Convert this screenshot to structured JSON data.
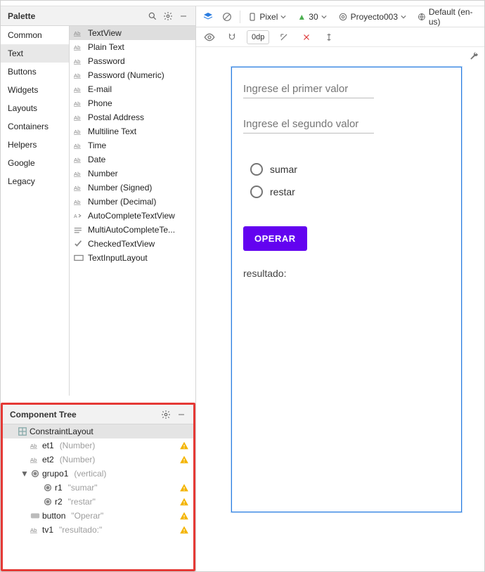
{
  "palette": {
    "title": "Palette",
    "categories": [
      "Common",
      "Text",
      "Buttons",
      "Widgets",
      "Layouts",
      "Containers",
      "Helpers",
      "Google",
      "Legacy"
    ],
    "selected_category": "Text",
    "items": [
      {
        "icon": "ab",
        "label": "TextView",
        "selected": true
      },
      {
        "icon": "ab",
        "label": "Plain Text"
      },
      {
        "icon": "ab",
        "label": "Password"
      },
      {
        "icon": "ab",
        "label": "Password (Numeric)"
      },
      {
        "icon": "ab",
        "label": "E-mail"
      },
      {
        "icon": "ab",
        "label": "Phone"
      },
      {
        "icon": "ab",
        "label": "Postal Address"
      },
      {
        "icon": "ab",
        "label": "Multiline Text"
      },
      {
        "icon": "ab",
        "label": "Time"
      },
      {
        "icon": "ab",
        "label": "Date"
      },
      {
        "icon": "ab",
        "label": "Number"
      },
      {
        "icon": "ab",
        "label": "Number (Signed)"
      },
      {
        "icon": "ab",
        "label": "Number (Decimal)"
      },
      {
        "icon": "auto",
        "label": "AutoCompleteTextView"
      },
      {
        "icon": "multi",
        "label": "MultiAutoCompleteTe..."
      },
      {
        "icon": "check",
        "label": "CheckedTextView"
      },
      {
        "icon": "input",
        "label": "TextInputLayout"
      }
    ]
  },
  "component_tree": {
    "title": "Component Tree",
    "rows": [
      {
        "depth": 0,
        "icon": "layout",
        "name": "ConstraintLayout",
        "hint": "",
        "warn": false,
        "selected": true,
        "expander": ""
      },
      {
        "depth": 1,
        "icon": "ab",
        "name": "et1",
        "hint": "(Number)",
        "warn": true
      },
      {
        "depth": 1,
        "icon": "ab",
        "name": "et2",
        "hint": "(Number)",
        "warn": true
      },
      {
        "depth": 1,
        "icon": "radiogroup",
        "name": "grupo1",
        "hint": "(vertical)",
        "warn": false,
        "expander": "▼"
      },
      {
        "depth": 2,
        "icon": "radio",
        "name": "r1",
        "hint": "\"sumar\"",
        "warn": true
      },
      {
        "depth": 2,
        "icon": "radio",
        "name": "r2",
        "hint": "\"restar\"",
        "warn": true
      },
      {
        "depth": 1,
        "icon": "button",
        "name": "button",
        "hint": "\"Operar\"",
        "warn": true
      },
      {
        "depth": 1,
        "icon": "ab",
        "name": "tv1",
        "hint": "\"resultado:\"",
        "warn": true
      }
    ]
  },
  "design_toolbar": {
    "device": "Pixel",
    "api": "30",
    "project": "Proyecto003",
    "locale": "Default (en-us)"
  },
  "sub_toolbar": {
    "odp": "0dp"
  },
  "mock": {
    "hint1": "Ingrese el primer valor",
    "hint2": "Ingrese el segundo valor",
    "radio1": "sumar",
    "radio2": "restar",
    "button": "OPERAR",
    "result": "resultado:"
  }
}
